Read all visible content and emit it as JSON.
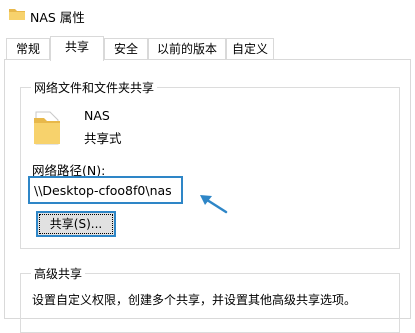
{
  "window": {
    "title": "NAS 属性"
  },
  "tabs": [
    {
      "label": "常规"
    },
    {
      "label": "共享"
    },
    {
      "label": "安全"
    },
    {
      "label": "以前的版本"
    },
    {
      "label": "自定义"
    }
  ],
  "network_share": {
    "group_label": "网络文件和文件夹共享",
    "folder_name": "NAS",
    "status": "共享式",
    "path_label": "网络路径(N):",
    "path_value": "\\\\Desktop-cfoo8f0\\nas",
    "share_button_label": "共享(S)..."
  },
  "advanced_share": {
    "group_label": "高级共享",
    "description": "设置自定义权限，创建多个共享，并设置其他高级共享选项。"
  },
  "colors": {
    "highlight": "#2e86c7",
    "folder": "#f5c75a"
  },
  "icons": {
    "title": "folder-icon",
    "large": "folder-icon",
    "annotation": "arrow-icon"
  }
}
